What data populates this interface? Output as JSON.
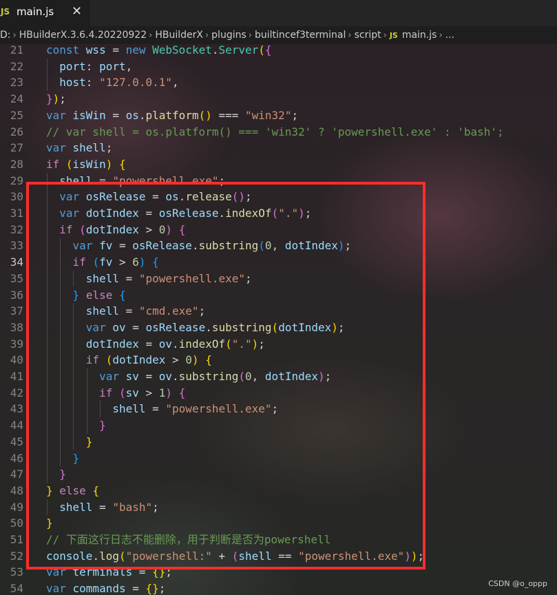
{
  "tab": {
    "icon_text": "JS",
    "label": "main.js",
    "close_glyph": "✕"
  },
  "breadcrumb": {
    "items": [
      "D:",
      "HBuilderX.3.6.4.20220922",
      "HBuilderX",
      "plugins",
      "builtincef3terminal",
      "script"
    ],
    "file_icon_text": "JS",
    "file": "main.js",
    "trailing": "...",
    "separator": "›"
  },
  "editor": {
    "active_line": 34,
    "lines": [
      {
        "n": 21,
        "tokens": [
          [
            "kw",
            "const "
          ],
          [
            "var",
            "wss"
          ],
          [
            "pun",
            " = "
          ],
          [
            "kw",
            "new "
          ],
          [
            "cls",
            "WebSocket"
          ],
          [
            "pun",
            "."
          ],
          [
            "cls",
            "Server"
          ],
          [
            "p1",
            "("
          ],
          [
            "p2",
            "{"
          ]
        ]
      },
      {
        "n": 22,
        "tokens": [
          [
            "pun",
            "  "
          ],
          [
            "var",
            "port"
          ],
          [
            "pun",
            ": "
          ],
          [
            "var",
            "port"
          ],
          [
            "pun",
            ","
          ]
        ]
      },
      {
        "n": 23,
        "tokens": [
          [
            "pun",
            "  "
          ],
          [
            "var",
            "host"
          ],
          [
            "pun",
            ": "
          ],
          [
            "str",
            "\"127.0.0.1\""
          ],
          [
            "pun",
            ","
          ]
        ]
      },
      {
        "n": 24,
        "tokens": [
          [
            "p2",
            "}"
          ],
          [
            "p1",
            ")"
          ],
          [
            "pun",
            ";"
          ]
        ]
      },
      {
        "n": 25,
        "tokens": [
          [
            "kw",
            "var "
          ],
          [
            "var",
            "isWin"
          ],
          [
            "pun",
            " = "
          ],
          [
            "var",
            "os"
          ],
          [
            "pun",
            "."
          ],
          [
            "fn",
            "platform"
          ],
          [
            "p1",
            "()"
          ],
          [
            "pun",
            " === "
          ],
          [
            "str",
            "\"win32\""
          ],
          [
            "pun",
            ";"
          ]
        ]
      },
      {
        "n": 26,
        "tokens": [
          [
            "cmt",
            "// var shell = os.platform() === 'win32' ? 'powershell.exe' : 'bash';"
          ]
        ]
      },
      {
        "n": 27,
        "tokens": [
          [
            "kw",
            "var "
          ],
          [
            "var",
            "shell"
          ],
          [
            "pun",
            ";"
          ]
        ]
      },
      {
        "n": 28,
        "tokens": [
          [
            "ctl",
            "if "
          ],
          [
            "p1",
            "("
          ],
          [
            "var",
            "isWin"
          ],
          [
            "p1",
            ")"
          ],
          [
            "pun",
            " "
          ],
          [
            "p1",
            "{"
          ]
        ]
      },
      {
        "n": 29,
        "tokens": [
          [
            "pun",
            "  "
          ],
          [
            "var",
            "shell"
          ],
          [
            "pun",
            " = "
          ],
          [
            "str",
            "\"powershell.exe\""
          ],
          [
            "pun",
            ";"
          ]
        ]
      },
      {
        "n": 30,
        "tokens": [
          [
            "pun",
            "  "
          ],
          [
            "kw",
            "var "
          ],
          [
            "var",
            "osRelease"
          ],
          [
            "pun",
            " = "
          ],
          [
            "var",
            "os"
          ],
          [
            "pun",
            "."
          ],
          [
            "fn",
            "release"
          ],
          [
            "p2",
            "()"
          ],
          [
            "pun",
            ";"
          ]
        ]
      },
      {
        "n": 31,
        "tokens": [
          [
            "pun",
            "  "
          ],
          [
            "kw",
            "var "
          ],
          [
            "var",
            "dotIndex"
          ],
          [
            "pun",
            " = "
          ],
          [
            "var",
            "osRelease"
          ],
          [
            "pun",
            "."
          ],
          [
            "fn",
            "indexOf"
          ],
          [
            "p2",
            "("
          ],
          [
            "str",
            "\".\""
          ],
          [
            "p2",
            ")"
          ],
          [
            "pun",
            ";"
          ]
        ]
      },
      {
        "n": 32,
        "tokens": [
          [
            "pun",
            "  "
          ],
          [
            "ctl",
            "if "
          ],
          [
            "p2",
            "("
          ],
          [
            "var",
            "dotIndex"
          ],
          [
            "pun",
            " > "
          ],
          [
            "num",
            "0"
          ],
          [
            "p2",
            ")"
          ],
          [
            "pun",
            " "
          ],
          [
            "p2",
            "{"
          ]
        ]
      },
      {
        "n": 33,
        "tokens": [
          [
            "pun",
            "    "
          ],
          [
            "kw",
            "var "
          ],
          [
            "var",
            "fv"
          ],
          [
            "pun",
            " = "
          ],
          [
            "var",
            "osRelease"
          ],
          [
            "pun",
            "."
          ],
          [
            "fn",
            "substring"
          ],
          [
            "p3",
            "("
          ],
          [
            "num",
            "0"
          ],
          [
            "pun",
            ", "
          ],
          [
            "var",
            "dotIndex"
          ],
          [
            "p3",
            ")"
          ],
          [
            "pun",
            ";"
          ]
        ]
      },
      {
        "n": 34,
        "tokens": [
          [
            "pun",
            "    "
          ],
          [
            "ctl",
            "if "
          ],
          [
            "p3",
            "("
          ],
          [
            "var",
            "fv"
          ],
          [
            "pun",
            " > "
          ],
          [
            "num",
            "6"
          ],
          [
            "p3",
            ")"
          ],
          [
            "pun",
            " "
          ],
          [
            "p3",
            "{"
          ]
        ]
      },
      {
        "n": 35,
        "tokens": [
          [
            "pun",
            "      "
          ],
          [
            "var",
            "shell"
          ],
          [
            "pun",
            " = "
          ],
          [
            "str",
            "\"powershell.exe\""
          ],
          [
            "pun",
            ";"
          ]
        ]
      },
      {
        "n": 36,
        "tokens": [
          [
            "pun",
            "    "
          ],
          [
            "p3",
            "}"
          ],
          [
            "pun",
            " "
          ],
          [
            "ctl",
            "else "
          ],
          [
            "p3",
            "{"
          ]
        ]
      },
      {
        "n": 37,
        "tokens": [
          [
            "pun",
            "      "
          ],
          [
            "var",
            "shell"
          ],
          [
            "pun",
            " = "
          ],
          [
            "str",
            "\"cmd.exe\""
          ],
          [
            "pun",
            ";"
          ]
        ]
      },
      {
        "n": 38,
        "tokens": [
          [
            "pun",
            "      "
          ],
          [
            "kw",
            "var "
          ],
          [
            "var",
            "ov"
          ],
          [
            "pun",
            " = "
          ],
          [
            "var",
            "osRelease"
          ],
          [
            "pun",
            "."
          ],
          [
            "fn",
            "substring"
          ],
          [
            "p1",
            "("
          ],
          [
            "var",
            "dotIndex"
          ],
          [
            "p1",
            ")"
          ],
          [
            "pun",
            ";"
          ]
        ]
      },
      {
        "n": 39,
        "tokens": [
          [
            "pun",
            "      "
          ],
          [
            "var",
            "dotIndex"
          ],
          [
            "pun",
            " = "
          ],
          [
            "var",
            "ov"
          ],
          [
            "pun",
            "."
          ],
          [
            "fn",
            "indexOf"
          ],
          [
            "p1",
            "("
          ],
          [
            "str",
            "\".\""
          ],
          [
            "p1",
            ")"
          ],
          [
            "pun",
            ";"
          ]
        ]
      },
      {
        "n": 40,
        "tokens": [
          [
            "pun",
            "      "
          ],
          [
            "ctl",
            "if "
          ],
          [
            "p1",
            "("
          ],
          [
            "var",
            "dotIndex"
          ],
          [
            "pun",
            " > "
          ],
          [
            "num",
            "0"
          ],
          [
            "p1",
            ")"
          ],
          [
            "pun",
            " "
          ],
          [
            "p1",
            "{"
          ]
        ]
      },
      {
        "n": 41,
        "tokens": [
          [
            "pun",
            "        "
          ],
          [
            "kw",
            "var "
          ],
          [
            "var",
            "sv"
          ],
          [
            "pun",
            " = "
          ],
          [
            "var",
            "ov"
          ],
          [
            "pun",
            "."
          ],
          [
            "fn",
            "substring"
          ],
          [
            "p2",
            "("
          ],
          [
            "num",
            "0"
          ],
          [
            "pun",
            ", "
          ],
          [
            "var",
            "dotIndex"
          ],
          [
            "p2",
            ")"
          ],
          [
            "pun",
            ";"
          ]
        ]
      },
      {
        "n": 42,
        "tokens": [
          [
            "pun",
            "        "
          ],
          [
            "ctl",
            "if "
          ],
          [
            "p2",
            "("
          ],
          [
            "var",
            "sv"
          ],
          [
            "pun",
            " > "
          ],
          [
            "num",
            "1"
          ],
          [
            "p2",
            ")"
          ],
          [
            "pun",
            " "
          ],
          [
            "p2",
            "{"
          ]
        ]
      },
      {
        "n": 43,
        "tokens": [
          [
            "pun",
            "          "
          ],
          [
            "var",
            "shell"
          ],
          [
            "pun",
            " = "
          ],
          [
            "str",
            "\"powershell.exe\""
          ],
          [
            "pun",
            ";"
          ]
        ]
      },
      {
        "n": 44,
        "tokens": [
          [
            "pun",
            "        "
          ],
          [
            "p2",
            "}"
          ]
        ]
      },
      {
        "n": 45,
        "tokens": [
          [
            "pun",
            "      "
          ],
          [
            "p1",
            "}"
          ]
        ]
      },
      {
        "n": 46,
        "tokens": [
          [
            "pun",
            "    "
          ],
          [
            "p3",
            "}"
          ]
        ]
      },
      {
        "n": 47,
        "tokens": [
          [
            "pun",
            "  "
          ],
          [
            "p2",
            "}"
          ]
        ]
      },
      {
        "n": 48,
        "tokens": [
          [
            "p1",
            "}"
          ],
          [
            "pun",
            " "
          ],
          [
            "ctl",
            "else "
          ],
          [
            "p1",
            "{"
          ]
        ]
      },
      {
        "n": 49,
        "tokens": [
          [
            "pun",
            "  "
          ],
          [
            "var",
            "shell"
          ],
          [
            "pun",
            " = "
          ],
          [
            "str",
            "\"bash\""
          ],
          [
            "pun",
            ";"
          ]
        ]
      },
      {
        "n": 50,
        "tokens": [
          [
            "p1",
            "}"
          ]
        ]
      },
      {
        "n": 51,
        "tokens": [
          [
            "cmt",
            "// 下面这行日志不能删除，用于判断是否为powershell"
          ]
        ]
      },
      {
        "n": 52,
        "tokens": [
          [
            "var",
            "console"
          ],
          [
            "pun",
            "."
          ],
          [
            "fn",
            "log"
          ],
          [
            "p1",
            "("
          ],
          [
            "str",
            "\"powershell:\""
          ],
          [
            "pun",
            " + "
          ],
          [
            "p2",
            "("
          ],
          [
            "var",
            "shell"
          ],
          [
            "pun",
            " == "
          ],
          [
            "str",
            "\"powershell.exe\""
          ],
          [
            "p2",
            ")"
          ],
          [
            "p1",
            ")"
          ],
          [
            "pun",
            ";"
          ]
        ]
      },
      {
        "n": 53,
        "tokens": [
          [
            "kw",
            "var "
          ],
          [
            "var",
            "terminals"
          ],
          [
            "pun",
            " = "
          ],
          [
            "p1",
            "{}"
          ],
          [
            "pun",
            ";"
          ]
        ]
      },
      {
        "n": 54,
        "tokens": [
          [
            "kw",
            "var "
          ],
          [
            "var",
            "commands"
          ],
          [
            "pun",
            " = "
          ],
          [
            "p1",
            "{}"
          ],
          [
            "pun",
            ";"
          ]
        ]
      }
    ]
  },
  "watermark": "CSDN @o_oppp"
}
